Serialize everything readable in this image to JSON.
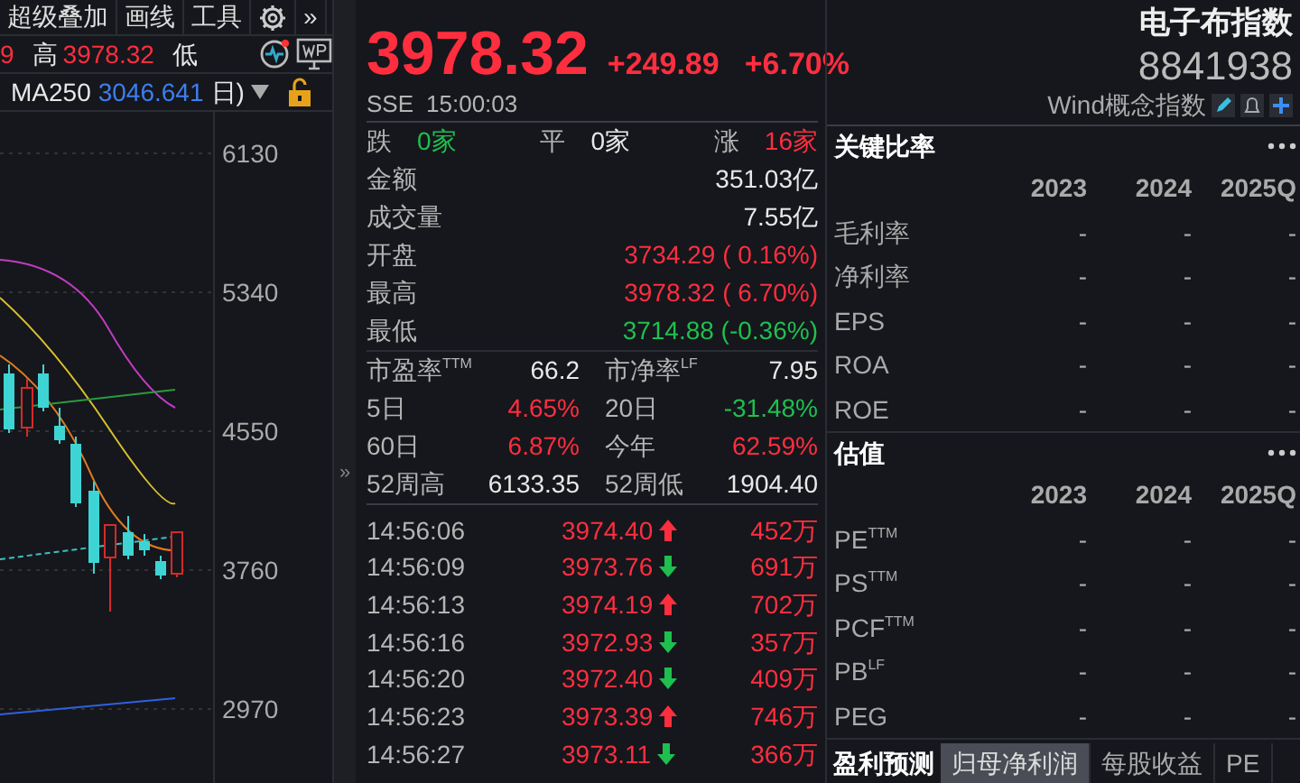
{
  "toolbar": {
    "items": [
      "超级叠加",
      "画线",
      "工具"
    ],
    "more_label": "»"
  },
  "quote_bar": {
    "fragment": "9",
    "high_label": "高",
    "high_value": "3978.32",
    "low_label": "低"
  },
  "ma_bar": {
    "label": "MA250",
    "value": "3046.641",
    "period": "日)"
  },
  "price_axis": [
    "6130",
    "5340",
    "4550",
    "3760",
    "2970"
  ],
  "collapse_label": "»",
  "quote": {
    "price": "3978.32",
    "change": "+249.89",
    "change_pct": "+6.70%",
    "exchange": "SSE",
    "time": "15:00:03"
  },
  "breadth": [
    {
      "label": "跌",
      "value": "0家",
      "color": "#1fbf4f"
    },
    {
      "label": "平",
      "value": "0家",
      "color": "#e8e8e8"
    },
    {
      "label": "涨",
      "value": "16家",
      "color": "#ff2e3f"
    }
  ],
  "stats": [
    {
      "label": "金额",
      "value": "351.03亿",
      "color": "#e8e8e8"
    },
    {
      "label": "成交量",
      "value": "7.55亿",
      "color": "#e8e8e8"
    },
    {
      "label": "开盘",
      "value": "3734.29 ( 0.16%)",
      "color": "#ff2e3f"
    },
    {
      "label": "最高",
      "value": "3978.32 ( 6.70%)",
      "color": "#ff2e3f"
    },
    {
      "label": "最低",
      "value": "3714.88 (-0.36%)",
      "color": "#1fbf4f"
    }
  ],
  "metrics": [
    {
      "label": "市盈率$^{TTM}$",
      "value": "66.2",
      "color": "#e8e8e8"
    },
    {
      "label": "市净率$^{LF}$",
      "value": "7.95",
      "color": "#e8e8e8"
    },
    {
      "label": "5日",
      "value": "4.65%",
      "color": "#ff2e3f"
    },
    {
      "label": "20日",
      "value": "-31.48%",
      "color": "#1fbf4f"
    },
    {
      "label": "60日",
      "value": "6.87%",
      "color": "#ff2e3f"
    },
    {
      "label": "今年",
      "value": "62.59%",
      "color": "#ff2e3f"
    },
    {
      "label": "52周高",
      "value": "6133.35",
      "color": "#e8e8e8"
    },
    {
      "label": "52周低",
      "value": "1904.40",
      "color": "#e8e8e8"
    }
  ],
  "ticks": [
    {
      "time": "14:56:06",
      "price": "3974.40",
      "kind": "up",
      "volume": "452万"
    },
    {
      "time": "14:56:09",
      "price": "3973.76",
      "kind": "down",
      "volume": "691万"
    },
    {
      "time": "14:56:13",
      "price": "3974.19",
      "kind": "up",
      "volume": "702万"
    },
    {
      "time": "14:56:16",
      "price": "3972.93",
      "kind": "down",
      "volume": "357万"
    },
    {
      "time": "14:56:20",
      "price": "3972.40",
      "kind": "down",
      "volume": "409万"
    },
    {
      "time": "14:56:23",
      "price": "3973.39",
      "kind": "up",
      "volume": "746万"
    },
    {
      "time": "14:56:27",
      "price": "3973.11",
      "kind": "down",
      "volume": "366万"
    }
  ],
  "index": {
    "name": "电子布指数",
    "code": "8841938",
    "category": "Wind概念指数"
  },
  "ratio_panels": [
    {
      "title": "关键比率",
      "columns": [
        "2023",
        "2024",
        "2025Q"
      ],
      "rows": [
        {
          "label": "毛利率",
          "values": [
            "-",
            "-",
            "-"
          ]
        },
        {
          "label": "净利率",
          "values": [
            "-",
            "-",
            "-"
          ]
        },
        {
          "label": "EPS",
          "values": [
            "-",
            "-",
            "-"
          ]
        },
        {
          "label": "ROA",
          "values": [
            "-",
            "-",
            "-"
          ]
        },
        {
          "label": "ROE",
          "values": [
            "-",
            "-",
            "-"
          ]
        }
      ]
    },
    {
      "title": "估值",
      "columns": [
        "2023",
        "2024",
        "2025Q"
      ],
      "rows": [
        {
          "label": "PE$^{TTM}$",
          "values": [
            "-",
            "-",
            "-"
          ]
        },
        {
          "label": "PS$^{TTM}$",
          "values": [
            "-",
            "-",
            "-"
          ]
        },
        {
          "label": "PCF$^{TTM}$",
          "values": [
            "-",
            "-",
            "-"
          ]
        },
        {
          "label": "PB$^{LF}$",
          "values": [
            "-",
            "-",
            "-"
          ]
        },
        {
          "label": "PEG",
          "values": [
            "-",
            "-",
            "-"
          ]
        }
      ]
    }
  ],
  "bottom_tabs": {
    "title": "盈利预测",
    "tabs": [
      {
        "label": "归母净利润",
        "selected": true
      },
      {
        "label": "每股收益",
        "selected": false
      },
      {
        "label": "PE",
        "selected": false
      }
    ]
  }
}
